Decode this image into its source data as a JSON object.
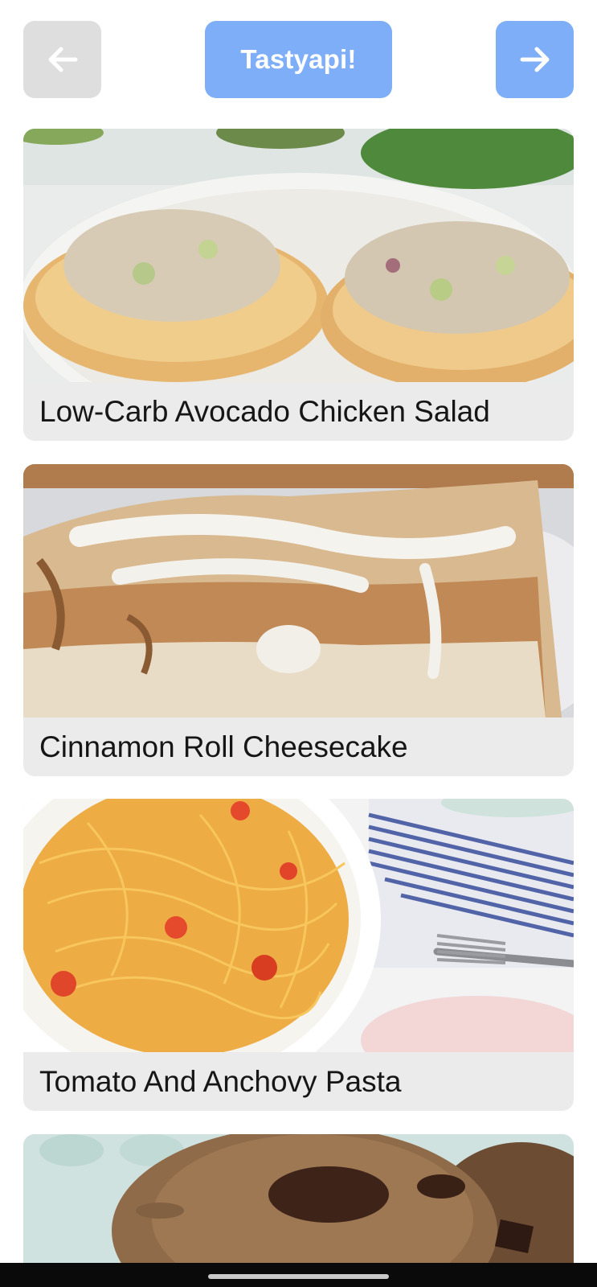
{
  "header": {
    "back_icon": "arrow-left-icon",
    "title": "Tastyapi!",
    "next_icon": "arrow-right-icon",
    "colors": {
      "primary": "#7eaef8",
      "disabled": "#dedede"
    }
  },
  "recipes": [
    {
      "title": "Low-Carb Avocado Chicken Salad"
    },
    {
      "title": "Cinnamon Roll Cheesecake"
    },
    {
      "title": "Tomato And Anchovy Pasta"
    },
    {
      "title": ""
    }
  ]
}
